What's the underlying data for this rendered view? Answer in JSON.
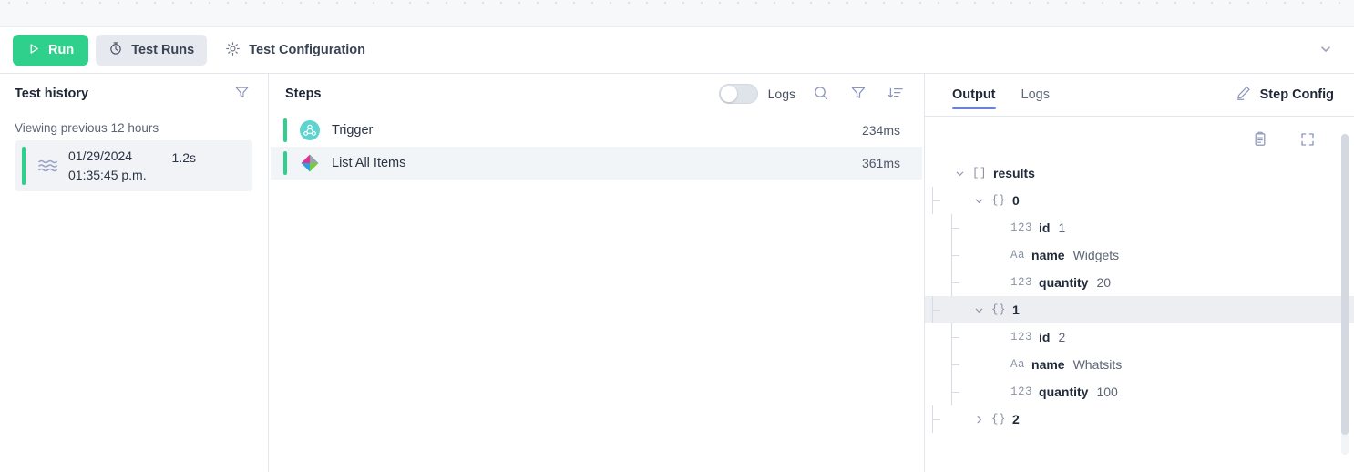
{
  "toolbar": {
    "run_label": "Run",
    "test_runs_label": "Test Runs",
    "test_config_label": "Test Configuration",
    "collapse_icon": "chevron-down-icon",
    "run_color": "#2ed08c",
    "active_tab_bg": "#e6e9ef"
  },
  "history": {
    "title": "Test history",
    "filter_icon": "filter-icon",
    "subtitle": "Viewing previous 12 hours",
    "items": [
      {
        "date": "01/29/2024",
        "time": "01:35:45 p.m.",
        "duration": "1.2s",
        "status_color": "#2ed08c",
        "icon": "waveform-lines-icon"
      }
    ]
  },
  "steps": {
    "title": "Steps",
    "logs_toggle_label": "Logs",
    "logs_toggle_on": false,
    "search_icon": "search-icon",
    "filter_icon": "filter-icon",
    "sort_icon": "sort-descending-icon",
    "rows": [
      {
        "name": "Trigger",
        "duration": "234ms",
        "status_color": "#2ed08c",
        "icon": "trigger-node-icon",
        "selected": false
      },
      {
        "name": "List All Items",
        "duration": "361ms",
        "status_color": "#2ed08c",
        "icon": "diamond-app-icon",
        "selected": true
      }
    ]
  },
  "output": {
    "tabs": [
      {
        "label": "Output",
        "active": true
      },
      {
        "label": "Logs",
        "active": false
      }
    ],
    "step_config_label": "Step Config",
    "edit_icon": "pencil-icon",
    "copy_icon": "clipboard-copy-icon",
    "expand_icon": "expand-fullscreen-icon",
    "active_underline_color": "#6b7fe0",
    "tree": [
      {
        "depth": 0,
        "chevron": "down",
        "type": "[]",
        "key": "results",
        "value": "",
        "highlighted": false
      },
      {
        "depth": 1,
        "chevron": "down",
        "type": "{}",
        "key": "0",
        "value": "",
        "highlighted": false
      },
      {
        "depth": 2,
        "chevron": "none",
        "type": "123",
        "key": "id",
        "value": "1",
        "highlighted": false
      },
      {
        "depth": 2,
        "chevron": "none",
        "type": "Aa",
        "key": "name",
        "value": "Widgets",
        "highlighted": false
      },
      {
        "depth": 2,
        "chevron": "none",
        "type": "123",
        "key": "quantity",
        "value": "20",
        "highlighted": false
      },
      {
        "depth": 1,
        "chevron": "down",
        "type": "{}",
        "key": "1",
        "value": "",
        "highlighted": true
      },
      {
        "depth": 2,
        "chevron": "none",
        "type": "123",
        "key": "id",
        "value": "2",
        "highlighted": false
      },
      {
        "depth": 2,
        "chevron": "none",
        "type": "Aa",
        "key": "name",
        "value": "Whatsits",
        "highlighted": false
      },
      {
        "depth": 2,
        "chevron": "none",
        "type": "123",
        "key": "quantity",
        "value": "100",
        "highlighted": false
      },
      {
        "depth": 1,
        "chevron": "right",
        "type": "{}",
        "key": "2",
        "value": "",
        "highlighted": false
      }
    ]
  }
}
